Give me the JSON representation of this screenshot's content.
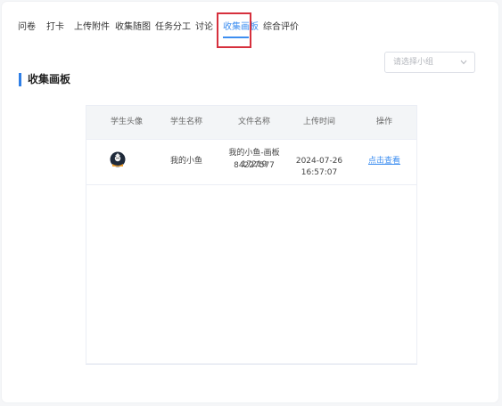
{
  "tabs": [
    {
      "label": "问卷"
    },
    {
      "label": "打卡"
    },
    {
      "label": "上传附件"
    },
    {
      "label": "收集随图"
    },
    {
      "label": "任务分工"
    },
    {
      "label": "讨论"
    },
    {
      "label": "收集画板"
    },
    {
      "label": "综合评价"
    }
  ],
  "active_tab": "收集画板",
  "page": {
    "title": "收集画板"
  },
  "group_select": {
    "placeholder": "请选择小组"
  },
  "table": {
    "headers": [
      "学生头像",
      "学生名称",
      "文件名称",
      "上传时间",
      "操作"
    ],
    "rows": [
      {
        "avatar_icon": "student-avatar-icon",
        "name": "我的小鱼",
        "file_line1": "我的小鱼-画板17219",
        "file_line2": "84227577",
        "time": "2024-07-26 16:57:07",
        "action": "点击查看"
      }
    ]
  },
  "colors": {
    "accent": "#3d8ef0",
    "highlight": "#d6303d",
    "title_bar": "#2f7fe6"
  }
}
